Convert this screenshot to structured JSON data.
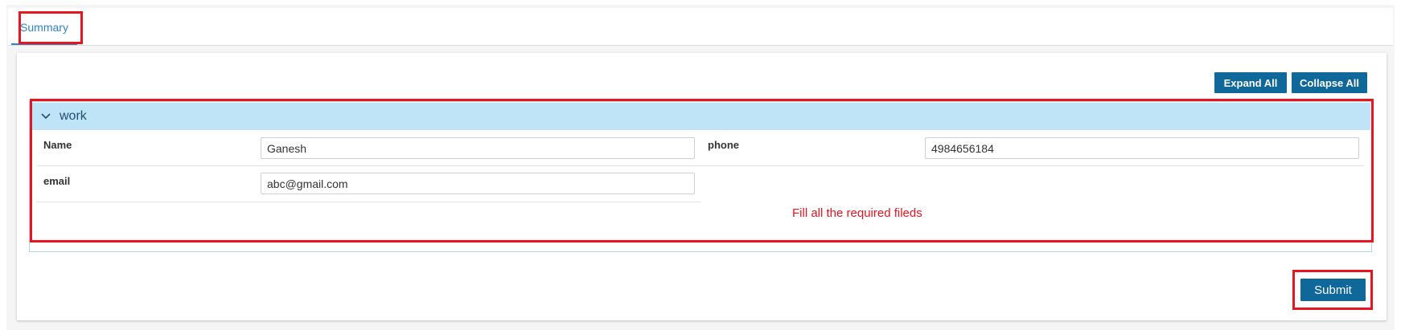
{
  "tabs": [
    {
      "label": "Summary"
    }
  ],
  "toolbar": {
    "expand_all_label": "Expand All",
    "collapse_all_label": "Collapse All"
  },
  "section": {
    "title": "work",
    "expanded": true,
    "fields": {
      "name": {
        "label": "Name",
        "value": "Ganesh"
      },
      "phone": {
        "label": "phone",
        "value": "4984656184"
      },
      "email": {
        "label": "email",
        "value": "abc@gmail.com"
      }
    },
    "error_message": "Fill all the required fileds"
  },
  "footer": {
    "submit_label": "Submit"
  },
  "colors": {
    "accent": "#0f679a",
    "tab_active": "#2e86c1",
    "section_header_bg": "#bfe3f7",
    "error": "#e8141f",
    "highlight_box": "#e8141f"
  }
}
